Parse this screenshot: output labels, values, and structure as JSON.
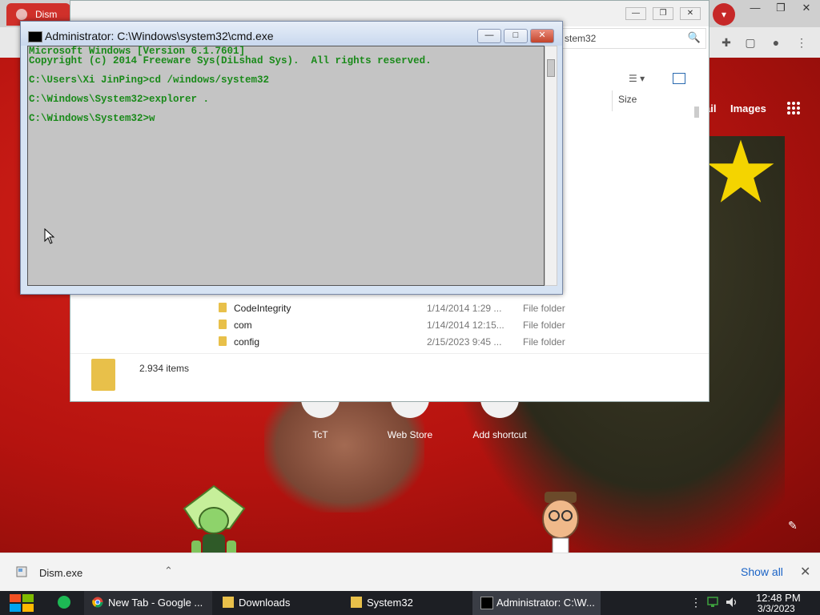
{
  "chrome": {
    "tab_title": "Dism",
    "new_tab_links": {
      "gmail": "ail",
      "images": "Images"
    },
    "shortcuts": [
      {
        "label": "TcT"
      },
      {
        "label": "Web Store"
      },
      {
        "label": "Add shortcut"
      }
    ]
  },
  "explorer": {
    "search_text": "stem32",
    "column_size": "Size",
    "rows": [
      {
        "name": "CodeIntegrity",
        "date": "1/14/2014 1:29 ...",
        "type": "File folder"
      },
      {
        "name": "com",
        "date": "1/14/2014 12:15...",
        "type": "File folder"
      },
      {
        "name": "config",
        "date": "2/15/2023 9:45 ...",
        "type": "File folder"
      }
    ],
    "status_count": "2.934 items"
  },
  "cmd": {
    "title": "Administrator: C:\\Windows\\system32\\cmd.exe",
    "lines": [
      "Microsoft Windows [Version 6.1.7601]",
      "Copyright (c) 2014 Freeware Sys(DiLshad Sys).  All rights reserved.",
      "",
      "C:\\Users\\Xi JinPing>cd /windows/system32",
      "",
      "C:\\Windows\\System32>explorer .",
      "",
      "C:\\Windows\\System32>w"
    ]
  },
  "download_bar": {
    "file_name": "Dism.exe",
    "show_all": "Show all"
  },
  "taskbar": {
    "items": [
      {
        "label": "New Tab - Google ...",
        "icon": "chrome-icon"
      },
      {
        "label": "Downloads",
        "icon": "folder-icon"
      },
      {
        "label": "System32",
        "icon": "folder-icon"
      },
      {
        "label": "Administrator: C:\\W...",
        "icon": "cmd-icon"
      }
    ],
    "clock_time": "12:48 PM",
    "clock_date": "3/3/2023"
  },
  "colors": {
    "wallpaper_red": "#b8120f",
    "cmd_text": "#1a8a1a",
    "cmd_bg": "#c4c4c4",
    "link_blue": "#1a63c6"
  }
}
